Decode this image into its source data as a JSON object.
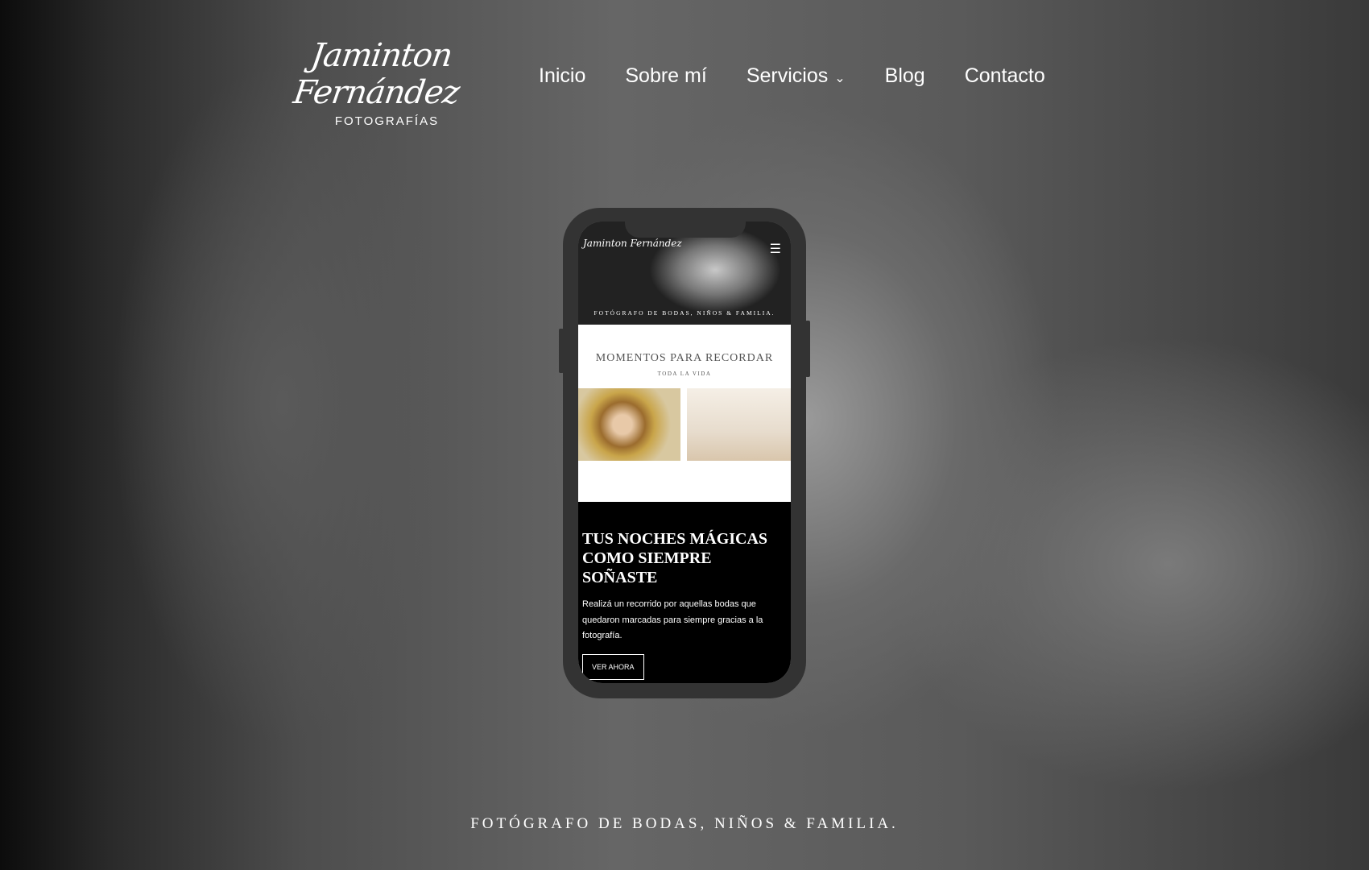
{
  "logo": {
    "script": "Jaminton Fernández",
    "sub": "FOTOGRAFÍAS"
  },
  "nav": {
    "items": [
      "Inicio",
      "Sobre mí",
      "Servicios",
      "Blog",
      "Contacto"
    ],
    "chevron": "⌄"
  },
  "phone": {
    "hero_logo": "Jaminton Fernández",
    "menu_icon": "☰",
    "hero_tagline": "FOTÓGRAFO DE BODAS, NIÑOS & FAMILIA.",
    "section_title": "MOMENTOS PARA RECORDAR",
    "section_sub": "TODA LA VIDA",
    "promo_title": "TUS NOCHES MÁGICAS COMO SIEMPRE SOÑASTE",
    "promo_text": "Realizá un recorrido por aquellas bodas que quedaron marcadas para siempre gracias a la fotografía.",
    "promo_button": "VER AHORA"
  },
  "tagline": "FOTÓGRAFO DE BODAS, NIÑOS & FAMILIA."
}
